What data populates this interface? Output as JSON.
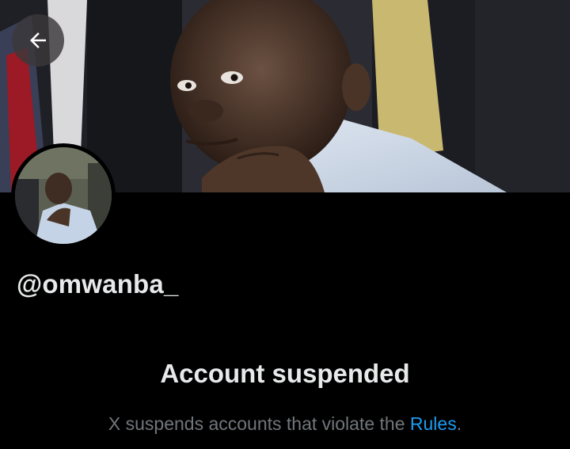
{
  "header": {
    "back_icon": "arrow-left-icon"
  },
  "profile": {
    "handle": "@omwanba_",
    "banner_image": "profile-banner-photo",
    "avatar_image": "profile-avatar-photo"
  },
  "suspension": {
    "title": "Account suspended",
    "description_prefix": "X suspends accounts that violate the ",
    "rules_link": "Rules",
    "description_suffix": "."
  },
  "colors": {
    "background": "#000000",
    "text_primary": "#e7e9ea",
    "text_secondary": "#71767b",
    "link": "#1d9bf0"
  }
}
